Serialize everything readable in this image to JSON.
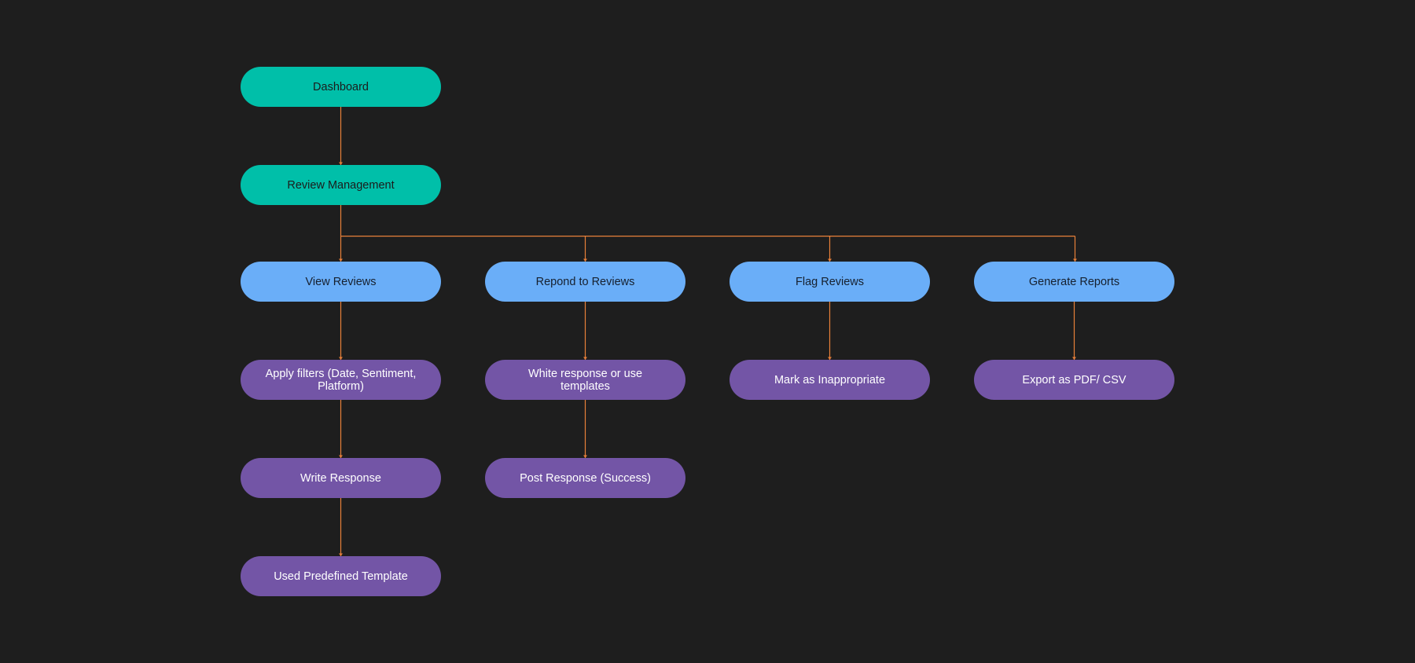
{
  "colors": {
    "background": "#1e1e1e",
    "root_nodes": "#00bfa9",
    "category_nodes": "#6aaef8",
    "action_nodes": "#7355a6",
    "connector": "#e8803a"
  },
  "nodes": {
    "dashboard": "Dashboard",
    "review_management": "Review Management",
    "view_reviews": "View Reviews",
    "respond_reviews": "Repond to Reviews",
    "flag_reviews": "Flag Reviews",
    "generate_reports": "Generate Reports",
    "apply_filters": "Apply filters (Date, Sentiment, Platform)",
    "white_response": "White response or use templates",
    "mark_inappropriate": "Mark as Inappropriate",
    "export": "Export as PDF/ CSV",
    "write_response": "Write Response",
    "post_response": "Post Response (Success)",
    "used_template": "Used Predefined Template"
  },
  "edges": [
    [
      "dashboard",
      "review_management"
    ],
    [
      "review_management",
      "view_reviews"
    ],
    [
      "review_management",
      "respond_reviews"
    ],
    [
      "review_management",
      "flag_reviews"
    ],
    [
      "review_management",
      "generate_reports"
    ],
    [
      "view_reviews",
      "apply_filters"
    ],
    [
      "apply_filters",
      "write_response"
    ],
    [
      "write_response",
      "used_template"
    ],
    [
      "respond_reviews",
      "white_response"
    ],
    [
      "white_response",
      "post_response"
    ],
    [
      "flag_reviews",
      "mark_inappropriate"
    ],
    [
      "generate_reports",
      "export"
    ]
  ]
}
